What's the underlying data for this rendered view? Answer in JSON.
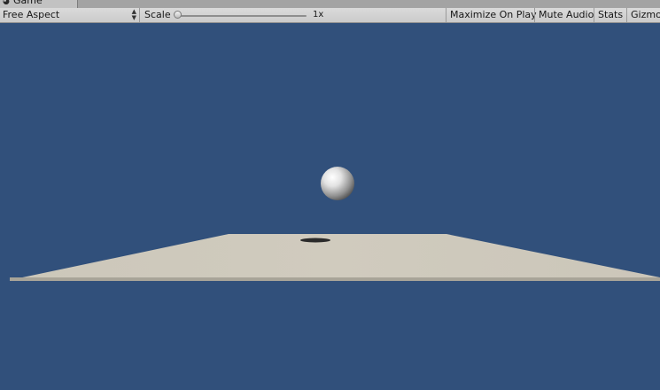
{
  "tab": {
    "label": "Game",
    "icon": "game-view-icon"
  },
  "toolbar": {
    "aspect": {
      "selected": "Free Aspect",
      "icon": "dropdown-arrows-icon"
    },
    "scale": {
      "label": "Scale",
      "value_text": "1x",
      "slider_fraction": 0.0
    },
    "buttons": {
      "maximize_on_play": "Maximize On Play",
      "mute_audio": "Mute Audio",
      "stats": "Stats",
      "gizmos": "Gizmo"
    }
  },
  "scene": {
    "background_color": "#31507b",
    "plane_color": "#cdc8bb",
    "sphere_color": "#e6e6e6"
  }
}
